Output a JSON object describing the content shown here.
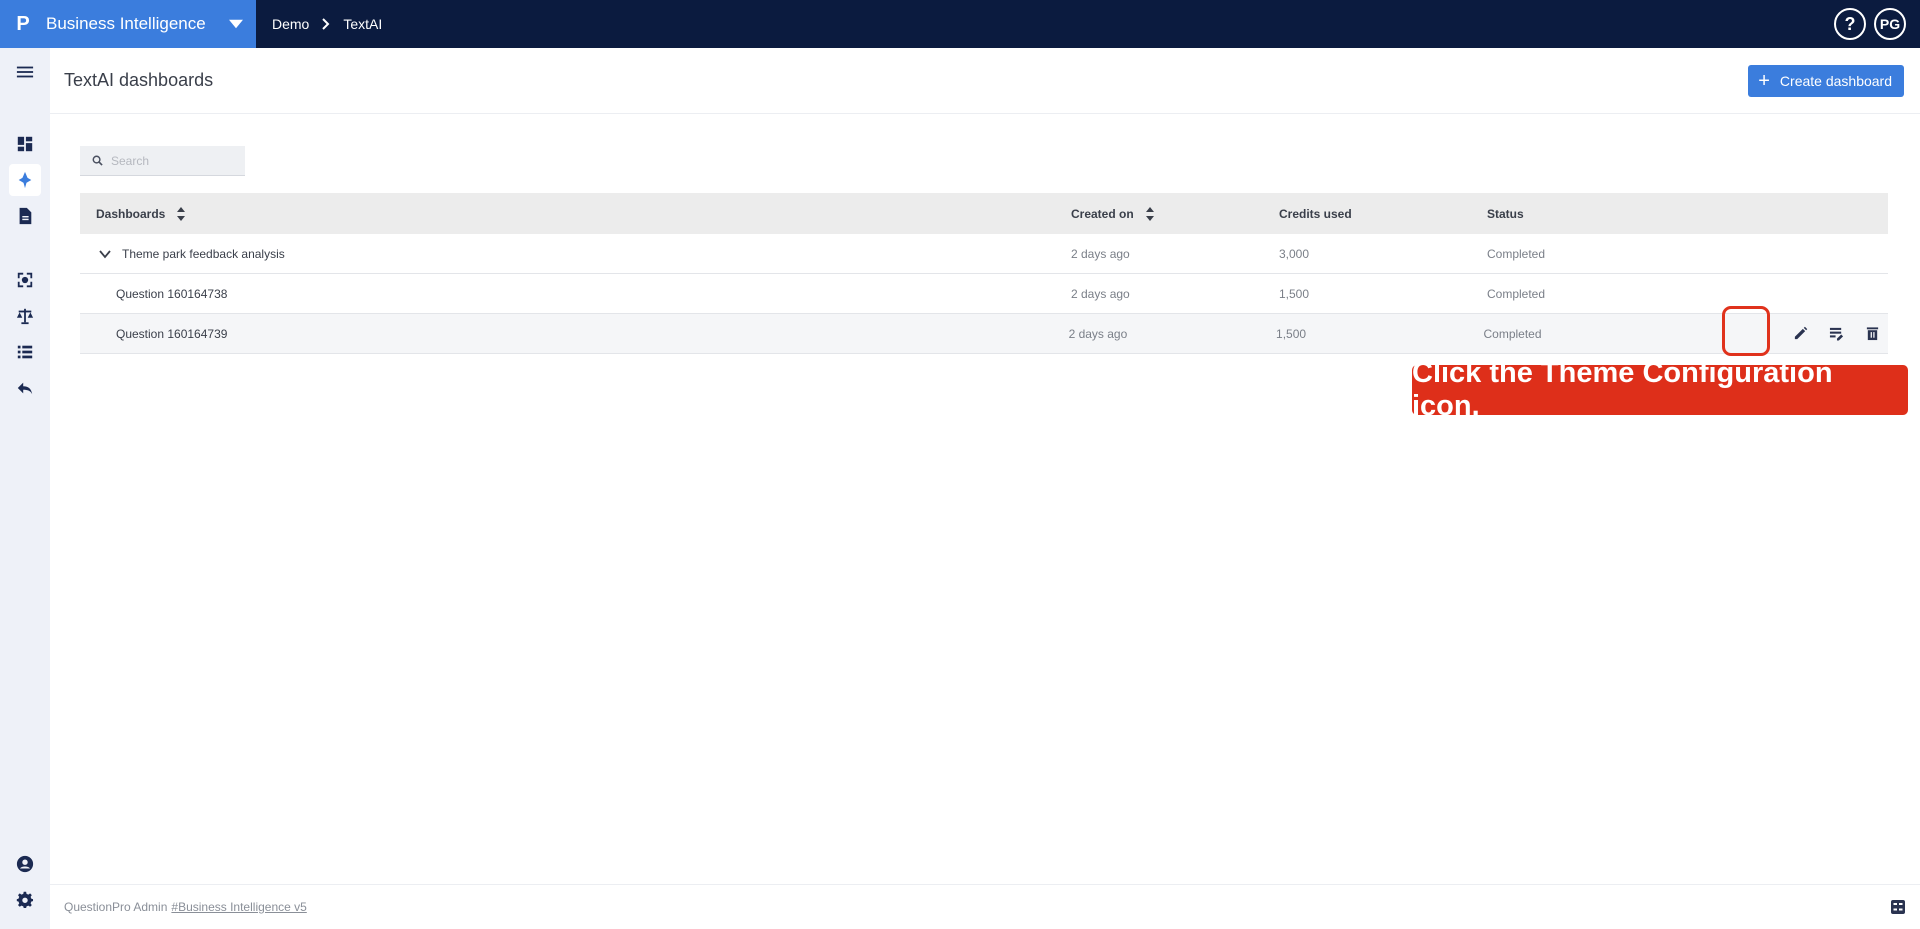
{
  "app": {
    "logo_letter": "P",
    "title": "Business Intelligence",
    "user_initials": "PG",
    "help_glyph": "?"
  },
  "breadcrumb": [
    "Demo",
    "TextAI"
  ],
  "page": {
    "title": "TextAI dashboards",
    "create_button": "Create dashboard"
  },
  "search": {
    "placeholder": "Search",
    "value": ""
  },
  "table": {
    "headers": {
      "name": "Dashboards",
      "created": "Created on",
      "credits": "Credits used",
      "status": "Status"
    },
    "rows": [
      {
        "name": "Theme park feedback analysis",
        "created": "2 days ago",
        "credits": "3,000",
        "status": "Completed"
      },
      {
        "name": "Question 160164738",
        "created": "2 days ago",
        "credits": "1,500",
        "status": "Completed"
      },
      {
        "name": "Question 160164739",
        "created": "2 days ago",
        "credits": "1,500",
        "status": "Completed"
      }
    ]
  },
  "callout": {
    "text": "Click the Theme Configuration icon."
  },
  "footer": {
    "prefix": "QuestionPro Admin",
    "link": "#Business Intelligence v5"
  },
  "colors": {
    "topbar": "#0b1b3f",
    "brand": "#3b7ddd",
    "accent": "#3b7ddd",
    "callout": "#de2f1a"
  },
  "icons": {
    "rail": [
      "menu-icon",
      "dashboard-icon",
      "textai-icon",
      "report-icon",
      "analytics-icon",
      "compare-icon",
      "list-icon",
      "back-icon",
      "admin-icon",
      "settings-icon"
    ],
    "row_actions": [
      "edit-icon",
      "theme-configuration-icon",
      "delete-icon"
    ]
  }
}
